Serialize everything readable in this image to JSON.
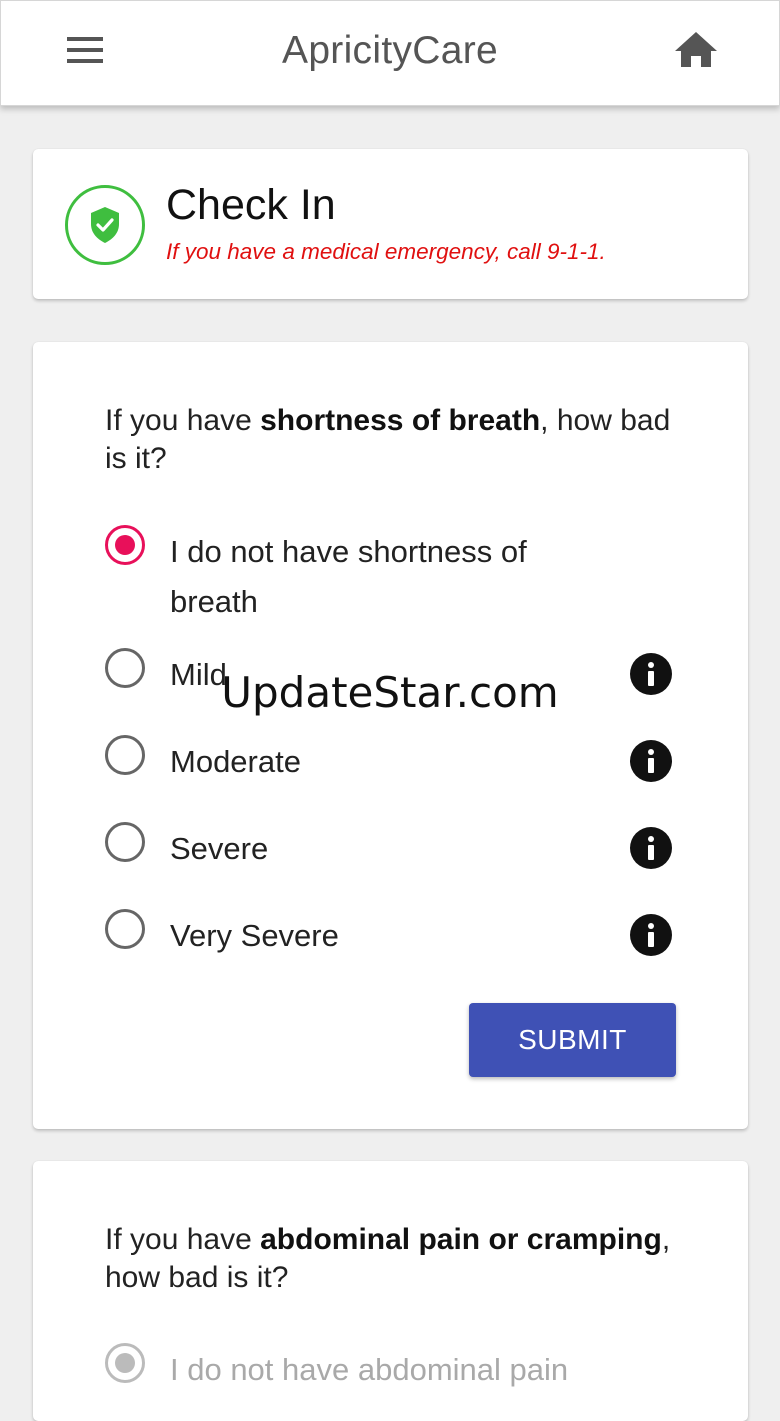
{
  "app_bar": {
    "title": "ApricityCare",
    "menu_icon": "hamburger-menu-icon",
    "home_icon": "home-icon"
  },
  "checkin": {
    "title": "Check In",
    "emergency_note": "If you have a medical emergency, call 9-1-1.",
    "icon": "shield-check-icon",
    "accent_color": "#3fbe3f",
    "note_color": "#e01010"
  },
  "question1": {
    "prefix": "If you have ",
    "bold": "shortness of breath",
    "suffix": ", how bad is it?",
    "options": [
      {
        "label": "I do not have shortness of breath",
        "selected": true
      },
      {
        "label": "Mild",
        "selected": false
      },
      {
        "label": "Moderate",
        "selected": false
      },
      {
        "label": "Severe",
        "selected": false
      },
      {
        "label": "Very Severe",
        "selected": false
      }
    ],
    "submit_label": "SUBMIT",
    "selected_color": "#e8105a",
    "button_color": "#3f51b5"
  },
  "question2": {
    "prefix": "If you have ",
    "bold": "abdominal pain or cramping",
    "suffix": ", how bad is it?",
    "options": [
      {
        "label": "I do not have abdominal pain",
        "selected": true
      }
    ]
  },
  "watermark": "UpdateStar.com"
}
